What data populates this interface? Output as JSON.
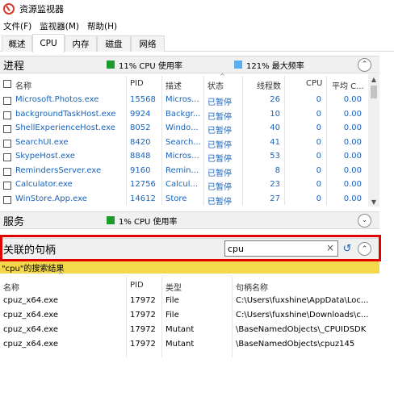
{
  "window": {
    "title": "资源监视器"
  },
  "menu": [
    "文件(F)",
    "监视器(M)",
    "帮助(H)"
  ],
  "tabs": [
    "概述",
    "CPU",
    "内存",
    "磁盘",
    "网络"
  ],
  "colors": {
    "green": "#1d9b2a",
    "blue": "#5aaef0",
    "link": "#1a63b8",
    "highlight": "#e00000",
    "resultbar": "#f2d84a"
  },
  "process": {
    "title": "进程",
    "legend_cpu": "11% CPU 使用率",
    "legend_freq": "121% 最大频率",
    "headers": {
      "name": "名称",
      "pid": "PID",
      "desc": "描述",
      "status": "状态",
      "threads": "线程数",
      "cpu": "CPU",
      "avg": "平均 C..."
    },
    "rows": [
      {
        "name": "Microsoft.Photos.exe",
        "pid": "15568",
        "desc": "Micros...",
        "status": "已暂停",
        "threads": "26",
        "cpu": "0",
        "avg": "0.00"
      },
      {
        "name": "backgroundTaskHost.exe",
        "pid": "9924",
        "desc": "Backgr...",
        "status": "已暂停",
        "threads": "10",
        "cpu": "0",
        "avg": "0.00"
      },
      {
        "name": "ShellExperienceHost.exe",
        "pid": "8052",
        "desc": "Windo...",
        "status": "已暂停",
        "threads": "40",
        "cpu": "0",
        "avg": "0.00"
      },
      {
        "name": "SearchUI.exe",
        "pid": "8420",
        "desc": "Search...",
        "status": "已暂停",
        "threads": "41",
        "cpu": "0",
        "avg": "0.00"
      },
      {
        "name": "SkypeHost.exe",
        "pid": "8848",
        "desc": "Micros...",
        "status": "已暂停",
        "threads": "53",
        "cpu": "0",
        "avg": "0.00"
      },
      {
        "name": "RemindersServer.exe",
        "pid": "9160",
        "desc": "Remin...",
        "status": "已暂停",
        "threads": "8",
        "cpu": "0",
        "avg": "0.00"
      },
      {
        "name": "Calculator.exe",
        "pid": "12756",
        "desc": "Calcul...",
        "status": "已暂停",
        "threads": "23",
        "cpu": "0",
        "avg": "0.00"
      },
      {
        "name": "WinStore.App.exe",
        "pid": "14612",
        "desc": "Store",
        "status": "已暂停",
        "threads": "27",
        "cpu": "0",
        "avg": "0.00"
      }
    ]
  },
  "services": {
    "title": "服务",
    "legend_cpu": "1% CPU 使用率"
  },
  "handles": {
    "title": "关联的句柄",
    "search_value": "cpu",
    "result_label": "\"cpu\"的搜索结果",
    "headers": {
      "name": "名称",
      "pid": "PID",
      "type": "类型",
      "handle": "句柄名称"
    },
    "rows": [
      {
        "name": "cpuz_x64.exe",
        "pid": "17972",
        "type": "File",
        "handle": "C:\\Users\\fuxshine\\AppData\\Loc..."
      },
      {
        "name": "cpuz_x64.exe",
        "pid": "17972",
        "type": "File",
        "handle": "C:\\Users\\fuxshine\\Downloads\\c..."
      },
      {
        "name": "cpuz_x64.exe",
        "pid": "17972",
        "type": "Mutant",
        "handle": "\\BaseNamedObjects\\_CPUIDSDK"
      },
      {
        "name": "cpuz_x64.exe",
        "pid": "17972",
        "type": "Mutant",
        "handle": "\\BaseNamedObjects\\cpuz145"
      }
    ]
  }
}
